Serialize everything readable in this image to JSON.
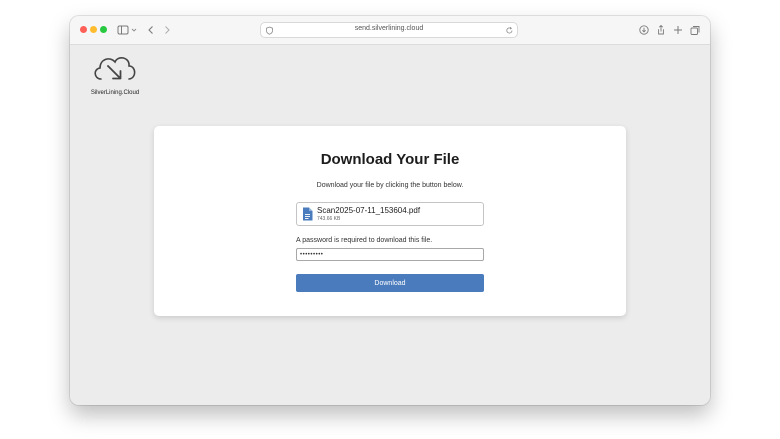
{
  "browser": {
    "url": "send.silverlining.cloud"
  },
  "brand": {
    "name": "SilverLining.Cloud"
  },
  "card": {
    "title": "Download Your File",
    "subtitle": "Download your file by clicking the button below.",
    "file": {
      "name": "Scan2025-07-11_153604.pdf",
      "size": "743.66 KB"
    },
    "password": {
      "label": "A password is required to download this file.",
      "value": "•••••••••"
    },
    "download_label": "Download"
  },
  "colors": {
    "accent": "#4a7bbd",
    "file_icon": "#4a7bbd",
    "traffic_red": "#fe5f57",
    "traffic_yellow": "#febc2e",
    "traffic_green": "#28c840"
  },
  "icons": {
    "toolbar": [
      "sidebar-icon",
      "chevron-down-icon",
      "back-icon",
      "forward-icon",
      "download-icon",
      "share-icon",
      "new-tab-icon",
      "tabs-overview-icon"
    ],
    "address": [
      "shield-icon",
      "reload-icon"
    ],
    "file": "document-icon",
    "logo": "cloud-download-icon"
  }
}
